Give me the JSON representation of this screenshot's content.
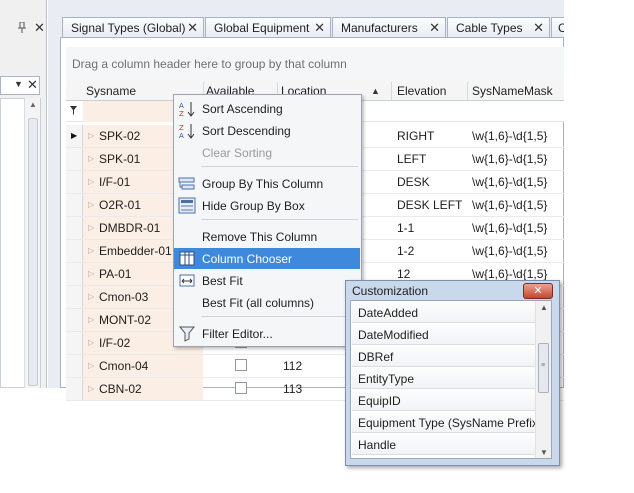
{
  "left_panel": {
    "pin_glyph": "ㅁ",
    "close_glyph": "✕",
    "combo_close_glyph": "✕"
  },
  "tabs": [
    {
      "label": "Signal Types (Global)"
    },
    {
      "label": "Global Equipment"
    },
    {
      "label": "Manufacturers"
    },
    {
      "label": "Cable Types"
    },
    {
      "label": "C"
    }
  ],
  "tab_close_glyph": "✕",
  "group_hint": "Drag a column header here to group by that column",
  "columns": {
    "sysname": "Sysname",
    "available": "Available",
    "location": "Location",
    "elevation": "Elevation",
    "sysnamemask": "SysNameMask"
  },
  "rows": [
    {
      "sysname": "SPK-02",
      "location": "",
      "elevation": "RIGHT",
      "mask": "\\w{1,6}-\\d{1,5}",
      "current": true
    },
    {
      "sysname": "SPK-01",
      "location": "",
      "elevation": "LEFT",
      "mask": "\\w{1,6}-\\d{1,5}"
    },
    {
      "sysname": "I/F-01",
      "location": "",
      "elevation": "DESK",
      "mask": "\\w{1,6}-\\d{1,5}"
    },
    {
      "sysname": "O2R-01",
      "location": "",
      "elevation": "DESK LEFT",
      "mask": "\\w{1,6}-\\d{1,5}"
    },
    {
      "sysname": "DMBDR-01",
      "location": "",
      "elevation": "1-1",
      "mask": "\\w{1,6}-\\d{1,5}"
    },
    {
      "sysname": "Embedder-01",
      "location": "",
      "elevation": "1-2",
      "mask": "\\w{1,6}-\\d{1,5}"
    },
    {
      "sysname": "PA-01",
      "location": "",
      "elevation": "12",
      "mask": "\\w{1,6}-\\d{1,5}"
    },
    {
      "sysname": "Cmon-03",
      "location": "",
      "elevation": "",
      "mask": ""
    },
    {
      "sysname": "MONT-02",
      "location": "",
      "elevation": "",
      "mask": ""
    },
    {
      "sysname": "I/F-02",
      "location": "",
      "elevation": "",
      "mask": ""
    },
    {
      "sysname": "Cmon-04",
      "location": "112",
      "elevation": "",
      "mask": ""
    },
    {
      "sysname": "CBN-02",
      "location": "113",
      "elevation": "",
      "mask": ""
    }
  ],
  "context_menu": {
    "sort_asc": "Sort Ascending",
    "sort_desc": "Sort Descending",
    "clear_sort": "Clear Sorting",
    "group_by": "Group By This Column",
    "hide_group_box": "Hide Group By Box",
    "remove_column": "Remove This Column",
    "column_chooser": "Column Chooser",
    "best_fit": "Best Fit",
    "best_fit_all": "Best Fit (all columns)",
    "filter_editor": "Filter Editor..."
  },
  "customization": {
    "title": "Customization",
    "close_glyph": "✕",
    "items": [
      "DateAdded",
      "DateModified",
      "DBRef",
      "EntityType",
      "EquipID",
      "Equipment Type (SysName Prefix)",
      "Handle"
    ]
  }
}
